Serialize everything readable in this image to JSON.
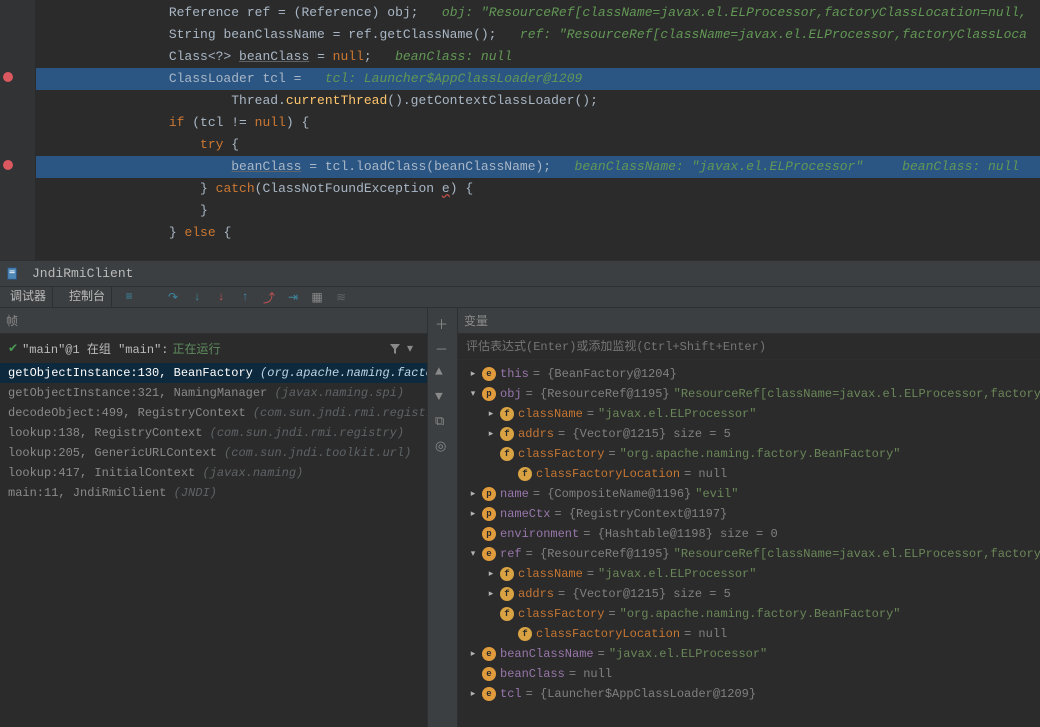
{
  "editor": {
    "lines": [
      {
        "indent": 16,
        "tokens": [
          [
            "cls",
            "Reference "
          ],
          [
            "var",
            "ref = ("
          ],
          [
            "cls",
            "Reference"
          ],
          [
            "var",
            ") obj;   "
          ],
          [
            "ann",
            "obj: \"ResourceRef[className=javax.el.ELProcessor,factoryClassLocation=null,"
          ]
        ]
      },
      {
        "indent": 16,
        "tokens": [
          [
            "cls",
            "String "
          ],
          [
            "var",
            "beanClassName = ref.getClassName();   "
          ],
          [
            "ann",
            "ref: \"ResourceRef[className=javax.el.ELProcessor,factoryClassLoca"
          ]
        ]
      },
      {
        "indent": 16,
        "tokens": [
          [
            "cls",
            "Class<?> "
          ],
          [
            "ul",
            "beanClass"
          ],
          [
            "var",
            " = "
          ],
          [
            "kw",
            "null"
          ],
          [
            "var",
            ";   "
          ],
          [
            "ann",
            "beanClass: null"
          ]
        ]
      },
      {
        "indent": 16,
        "hl": "bp",
        "tokens": [
          [
            "cls",
            "ClassLoader "
          ],
          [
            "var",
            "tcl =   "
          ],
          [
            "ann",
            "tcl: Launcher$AppClassLoader@1209"
          ]
        ]
      },
      {
        "indent": 24,
        "tokens": [
          [
            "var",
            "Thread."
          ],
          [
            "fn",
            "currentThread"
          ],
          [
            "var",
            "()."
          ],
          [
            "var",
            "getContextClassLoader();"
          ]
        ]
      },
      {
        "indent": 16,
        "tokens": [
          [
            "kw",
            "if "
          ],
          [
            "var",
            "(tcl != "
          ],
          [
            "kw",
            "null"
          ],
          [
            "var",
            ") {"
          ]
        ]
      },
      {
        "indent": 20,
        "tokens": [
          [
            "kw",
            "try "
          ],
          [
            "var",
            "{"
          ]
        ]
      },
      {
        "indent": 24,
        "hl": "ex",
        "tokens": [
          [
            "ul",
            "beanClass"
          ],
          [
            "var",
            " = tcl.loadClass("
          ],
          [
            "var",
            "beanClassName"
          ],
          [
            "var",
            ");   "
          ],
          [
            "ann",
            "beanClassName: \"javax.el.ELProcessor\"     beanClass: null"
          ]
        ]
      },
      {
        "indent": 20,
        "tokens": [
          [
            "var",
            "} "
          ],
          [
            "kw",
            "catch"
          ],
          [
            "var",
            "("
          ],
          [
            "cls",
            "ClassNotFoundException "
          ],
          [
            "err",
            "e"
          ],
          [
            "var",
            ") {"
          ]
        ]
      },
      {
        "indent": 20,
        "tokens": [
          [
            "var",
            "}"
          ]
        ]
      },
      {
        "indent": 16,
        "tokens": [
          [
            "var",
            "} "
          ],
          [
            "kw",
            "else "
          ],
          [
            "var",
            "{"
          ]
        ]
      }
    ],
    "breakpoints_at": [
      3,
      7
    ]
  },
  "tabheader": {
    "title": "JndiRmiClient"
  },
  "toolbar": {
    "tab_debugger": "调试器",
    "tab_console": "控制台"
  },
  "frames": {
    "header": "帧",
    "status_prefix": "\"main\"@1 在组 \"main\": ",
    "status_state": "正在运行",
    "items": [
      {
        "sig": "getObjectInstance:130, BeanFactory",
        "pkg": "(org.apache.naming.factory)",
        "active": true
      },
      {
        "sig": "getObjectInstance:321, NamingManager",
        "pkg": "(javax.naming.spi)"
      },
      {
        "sig": "decodeObject:499, RegistryContext",
        "pkg": "(com.sun.jndi.rmi.registry)"
      },
      {
        "sig": "lookup:138, RegistryContext",
        "pkg": "(com.sun.jndi.rmi.registry)"
      },
      {
        "sig": "lookup:205, GenericURLContext",
        "pkg": "(com.sun.jndi.toolkit.url)"
      },
      {
        "sig": "lookup:417, InitialContext",
        "pkg": "(javax.naming)"
      },
      {
        "sig": "main:11, JndiRmiClient",
        "pkg": "(JNDI)"
      }
    ]
  },
  "vars": {
    "header": "变量",
    "expr_placeholder": "评估表达式(Enter)或添加监视(Ctrl+Shift+Enter)",
    "tree": [
      {
        "d": 0,
        "tw": ">",
        "b": "e",
        "name": "this",
        "rest": " = {BeanFactory@1204}"
      },
      {
        "d": 0,
        "tw": "v",
        "b": "p",
        "name": "obj",
        "rest": " = {ResourceRef@1195} ",
        "str": "\"ResourceRef[className=javax.el.ELProcessor,factoryClassLocation=nu"
      },
      {
        "d": 1,
        "tw": ">",
        "b": "f",
        "cf": true,
        "name": "className",
        "rest": " = ",
        "str": "\"javax.el.ELProcessor\""
      },
      {
        "d": 1,
        "tw": ">",
        "b": "f",
        "cf": true,
        "name": "addrs",
        "rest": " = {Vector@1215}  size = 5"
      },
      {
        "d": 1,
        "tw": "",
        "b": "f",
        "cf": true,
        "name": "classFactory",
        "rest": " = ",
        "str": "\"org.apache.naming.factory.BeanFactory\""
      },
      {
        "d": 2,
        "tw": "",
        "b": "f",
        "cf": true,
        "name": "classFactoryLocation",
        "rest": " = null"
      },
      {
        "d": 0,
        "tw": ">",
        "b": "p",
        "name": "name",
        "rest": " = {CompositeName@1196} ",
        "str": "\"evil\""
      },
      {
        "d": 0,
        "tw": ">",
        "b": "p",
        "name": "nameCtx",
        "rest": " = {RegistryContext@1197}"
      },
      {
        "d": 0,
        "tw": "",
        "b": "p",
        "name": "environment",
        "rest": " = {Hashtable@1198}  size = 0"
      },
      {
        "d": 0,
        "tw": "v",
        "b": "e",
        "name": "ref",
        "rest": " = {ResourceRef@1195} ",
        "str": "\"ResourceRef[className=javax.el.ELProcessor,factoryClassLocation=nu"
      },
      {
        "d": 1,
        "tw": ">",
        "b": "f",
        "cf": true,
        "name": "className",
        "rest": " = ",
        "str": "\"javax.el.ELProcessor\""
      },
      {
        "d": 1,
        "tw": ">",
        "b": "f",
        "cf": true,
        "name": "addrs",
        "rest": " = {Vector@1215}  size = 5"
      },
      {
        "d": 1,
        "tw": "",
        "b": "f",
        "cf": true,
        "name": "classFactory",
        "rest": " = ",
        "str": "\"org.apache.naming.factory.BeanFactory\""
      },
      {
        "d": 2,
        "tw": "",
        "b": "f",
        "cf": true,
        "name": "classFactoryLocation",
        "rest": " = null"
      },
      {
        "d": 0,
        "tw": ">",
        "b": "e",
        "name": "beanClassName",
        "rest": " = ",
        "str": "\"javax.el.ELProcessor\""
      },
      {
        "d": 0,
        "tw": "",
        "b": "e",
        "name": "beanClass",
        "rest": " = null"
      },
      {
        "d": 0,
        "tw": ">",
        "b": "e",
        "name": "tcl",
        "rest": " = {Launcher$AppClassLoader@1209}"
      }
    ]
  }
}
